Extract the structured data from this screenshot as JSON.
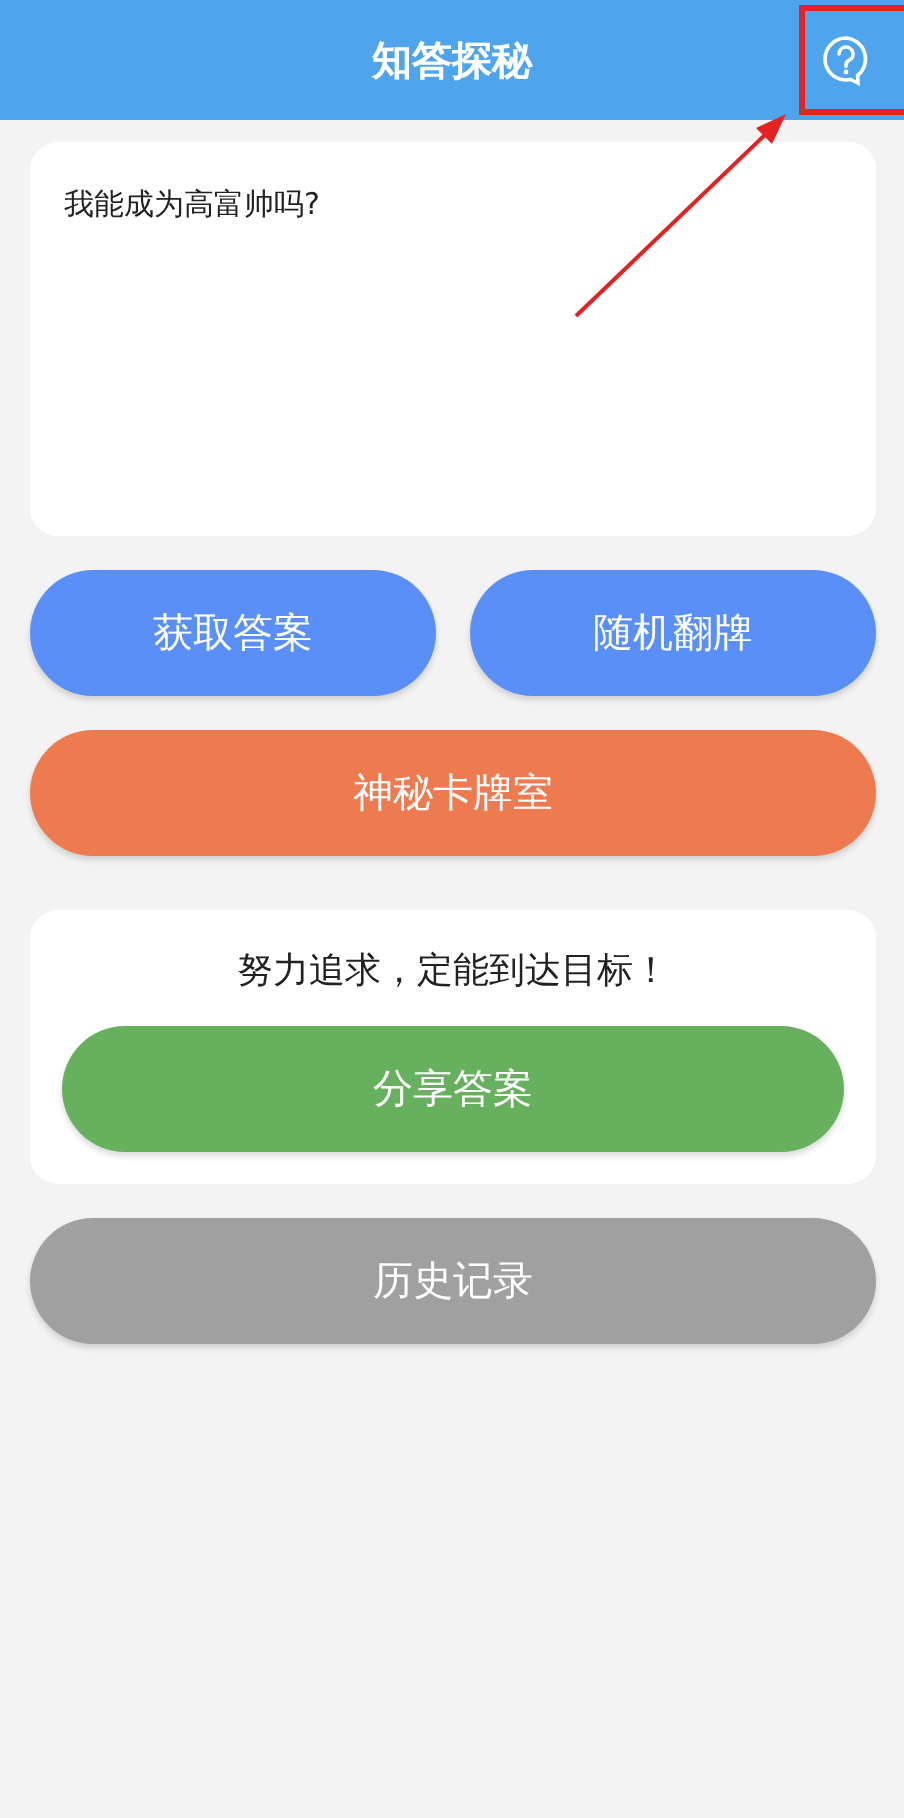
{
  "header": {
    "title": "知答探秘"
  },
  "question": {
    "value": "我能成为高富帅吗?"
  },
  "buttons": [
    {
      "label": "获取答案",
      "kind": "primary"
    },
    {
      "label": "随机翻牌",
      "kind": "primary"
    },
    {
      "label": "神秘卡牌室",
      "kind": "accent"
    }
  ],
  "answer": {
    "text": "努力追求，定能到达目标！",
    "share_button": "分享答案"
  },
  "history_button": "历史记录"
}
